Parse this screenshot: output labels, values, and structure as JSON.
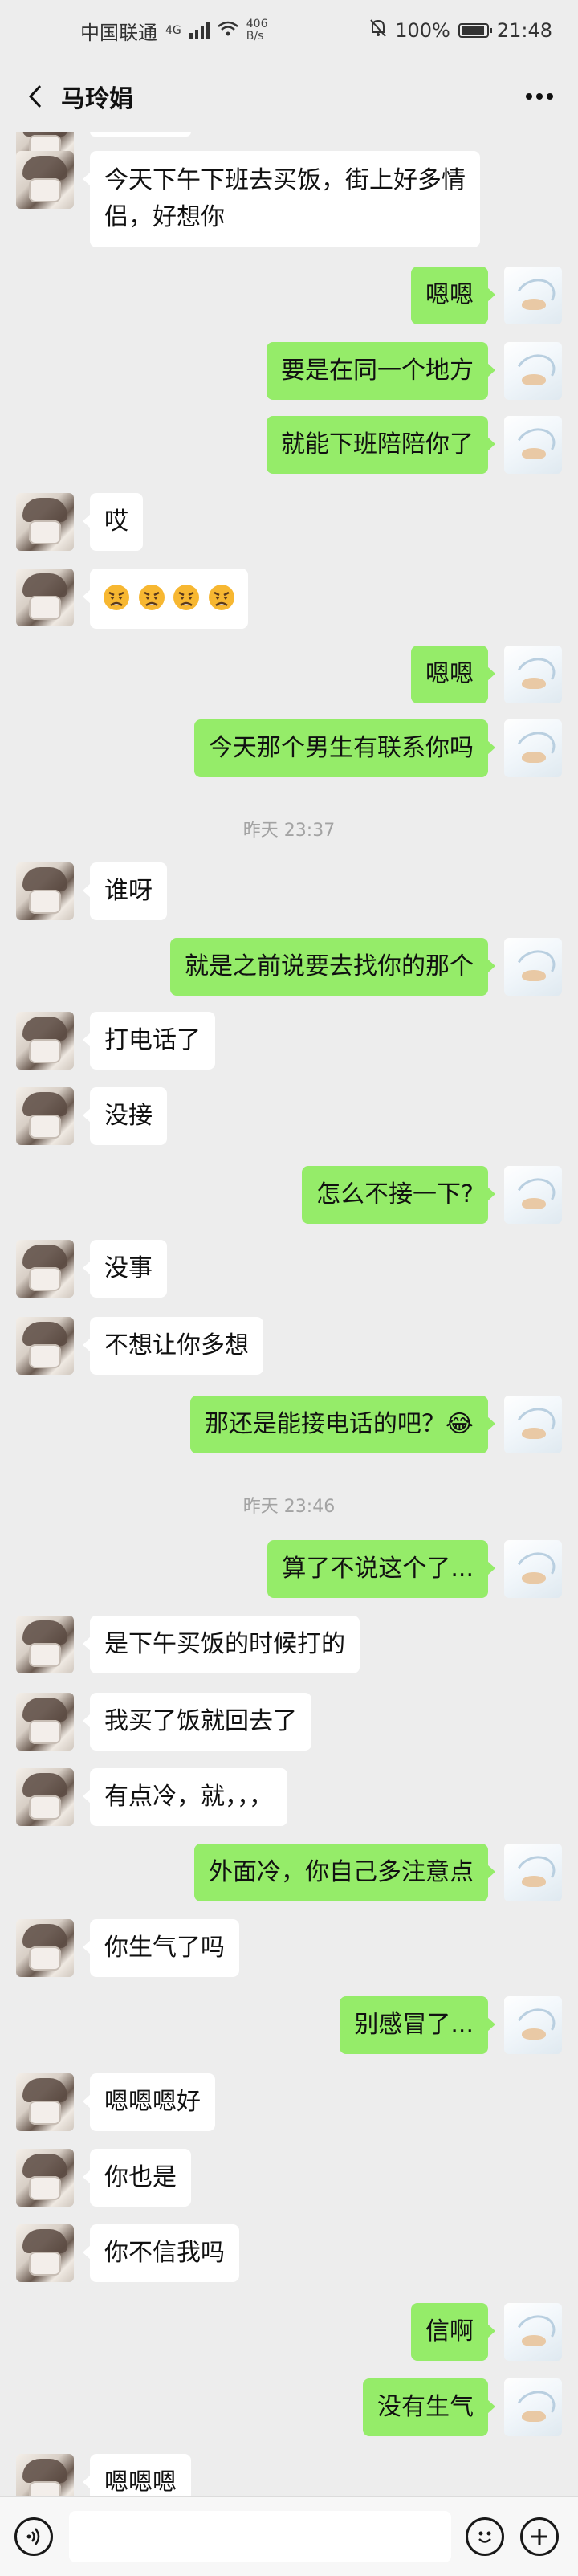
{
  "status_bar": {
    "carrier": "中国联通",
    "network_type": "4G",
    "speed_value": "406",
    "speed_unit": "B/s",
    "battery": "100%",
    "time": "21:48"
  },
  "header": {
    "title": "马玲娟"
  },
  "messages": [
    {
      "side": "left",
      "text": "今天下午下班去买饭，街上好多情侣，好想你"
    },
    {
      "side": "right",
      "text": "嗯嗯"
    },
    {
      "side": "right",
      "text": "要是在同一个地方"
    },
    {
      "side": "right",
      "text": "就能下班陪陪你了"
    },
    {
      "side": "left",
      "text": "哎"
    },
    {
      "side": "left",
      "text": "😡😡😡😡",
      "emoji_name": "angry-face-emoji",
      "emoji_count": 4
    },
    {
      "side": "right",
      "text": "嗯嗯"
    },
    {
      "side": "right",
      "text": "今天那个男生有联系你吗"
    },
    {
      "side": "left",
      "text": "谁呀"
    },
    {
      "side": "right",
      "text": "就是之前说要去找你的那个"
    },
    {
      "side": "left",
      "text": "打电话了"
    },
    {
      "side": "left",
      "text": "没接"
    },
    {
      "side": "right",
      "text": "怎么不接一下?"
    },
    {
      "side": "left",
      "text": "没事"
    },
    {
      "side": "left",
      "text": "不想让你多想"
    },
    {
      "side": "right",
      "text": "那还是能接电话的吧？😂"
    },
    {
      "side": "right",
      "text": "算了不说这个了..."
    },
    {
      "side": "left",
      "text": "是下午买饭的时候打的"
    },
    {
      "side": "left",
      "text": "我买了饭就回去了"
    },
    {
      "side": "left",
      "text": "有点冷，就，，，"
    },
    {
      "side": "right",
      "text": "外面冷，你自己多注意点"
    },
    {
      "side": "left",
      "text": "你生气了吗"
    },
    {
      "side": "right",
      "text": "别感冒了..."
    },
    {
      "side": "left",
      "text": "嗯嗯嗯好"
    },
    {
      "side": "left",
      "text": "你也是"
    },
    {
      "side": "left",
      "text": "你不信我吗"
    },
    {
      "side": "right",
      "text": "信啊"
    },
    {
      "side": "right",
      "text": "没有生气"
    },
    {
      "side": "left",
      "text": "嗯嗯嗯"
    }
  ],
  "timestamps": [
    {
      "text": "昨天 23:37"
    },
    {
      "text": "昨天 23:46"
    }
  ],
  "input_bar": {
    "placeholder": ""
  },
  "colors": {
    "background": "#EDEDED",
    "sent_bubble": "#95EC69",
    "received_bubble": "#FFFFFF",
    "timestamp": "#A3A3A3"
  }
}
